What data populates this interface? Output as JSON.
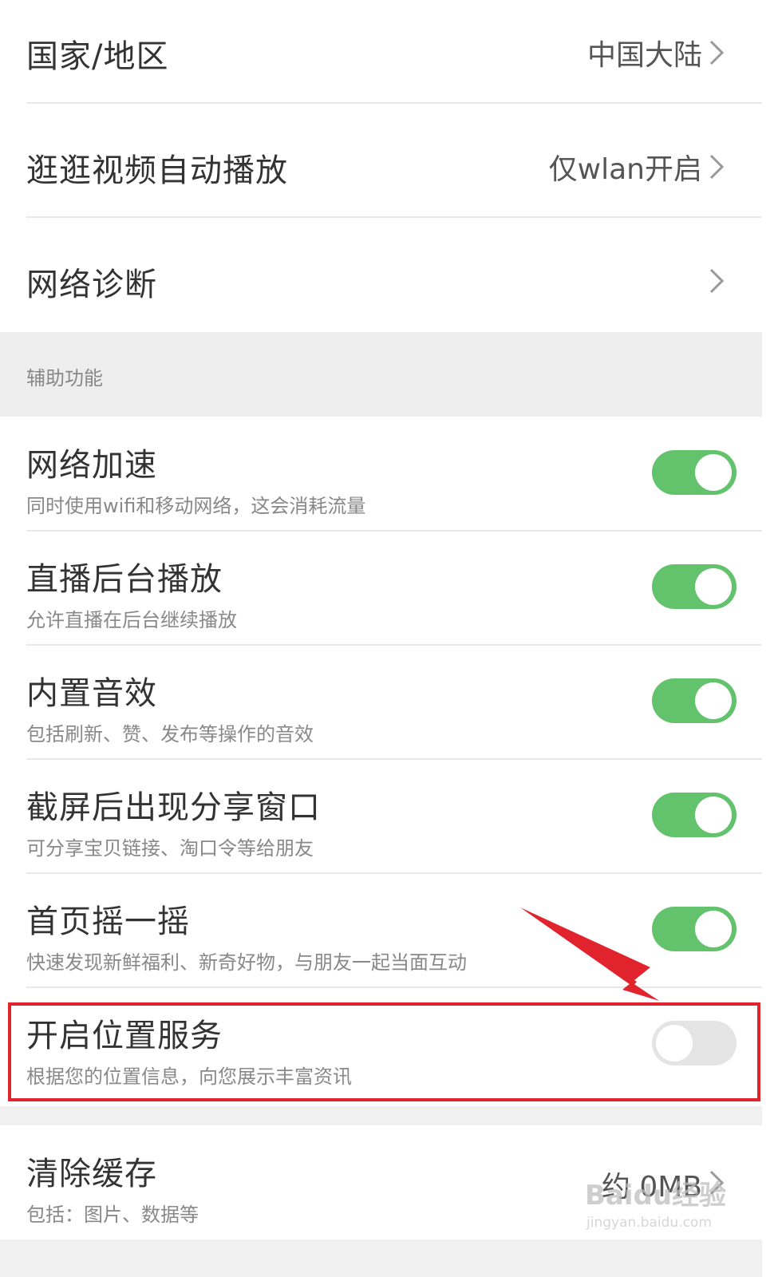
{
  "nav_rows": [
    {
      "title": "国家/地区",
      "value": "中国大陆"
    },
    {
      "title": "逛逛视频自动播放",
      "value": "仅wlan开启"
    },
    {
      "title": "网络诊断",
      "value": ""
    }
  ],
  "section_header": "辅助功能",
  "toggle_rows": [
    {
      "title": "网络加速",
      "subtitle": "同时使用wifi和移动网络，这会消耗流量",
      "enabled": true
    },
    {
      "title": "直播后台播放",
      "subtitle": "允许直播在后台继续播放",
      "enabled": true
    },
    {
      "title": "内置音效",
      "subtitle": "包括刷新、赞、发布等操作的音效",
      "enabled": true
    },
    {
      "title": "截屏后出现分享窗口",
      "subtitle": "可分享宝贝链接、淘口令等给朋友",
      "enabled": true
    },
    {
      "title": "首页摇一摇",
      "subtitle": "快速发现新鲜福利、新奇好物，与朋友一起当面互动",
      "enabled": true
    },
    {
      "title": "开启位置服务",
      "subtitle": "根据您的位置信息，向您展示丰富资讯",
      "enabled": false
    }
  ],
  "cache": {
    "title": "清除缓存",
    "subtitle": "包括：图片、数据等",
    "value": "约 0MB"
  },
  "watermark": {
    "main": "Baidu经验",
    "sub": "jingyan.baidu.com"
  },
  "colors": {
    "toggle_on": "#63c26c",
    "toggle_off": "#e4e4e4",
    "highlight": "#e0232d"
  }
}
